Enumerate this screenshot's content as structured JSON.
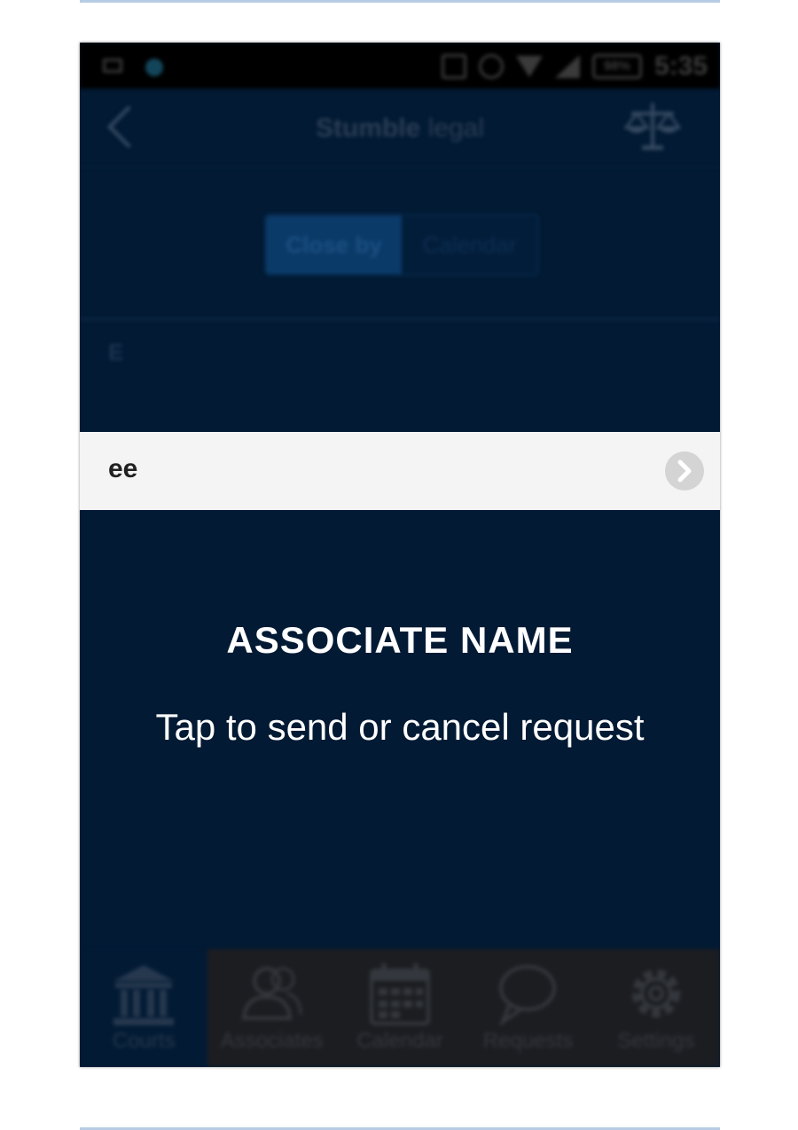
{
  "status_bar": {
    "battery": "98%",
    "time": "5:35"
  },
  "header": {
    "title_bold": "Stumble",
    "title_light": " legal"
  },
  "segmented": {
    "options": [
      "Close by",
      "Calendar"
    ],
    "selected": "Close by"
  },
  "list": {
    "section_letter": "E",
    "rows": [
      {
        "label": "ee"
      }
    ]
  },
  "overlay": {
    "title": "ASSOCIATE NAME",
    "subtitle": "Tap to send or cancel request"
  },
  "tab_bar": {
    "selected": "Courts",
    "tabs": [
      {
        "label": "Courts",
        "icon": "courthouse-icon"
      },
      {
        "label": "Associates",
        "icon": "people-icon"
      },
      {
        "label": "Calendar",
        "icon": "calendar-icon"
      },
      {
        "label": "Requests",
        "icon": "speech-bubble-icon"
      },
      {
        "label": "Settings",
        "icon": "gear-icon"
      }
    ]
  },
  "colors": {
    "background": "#021a34",
    "row_highlight": "#f4f4f4",
    "overlay_text": "#ffffff",
    "tab_bar": "#1b1d21"
  }
}
